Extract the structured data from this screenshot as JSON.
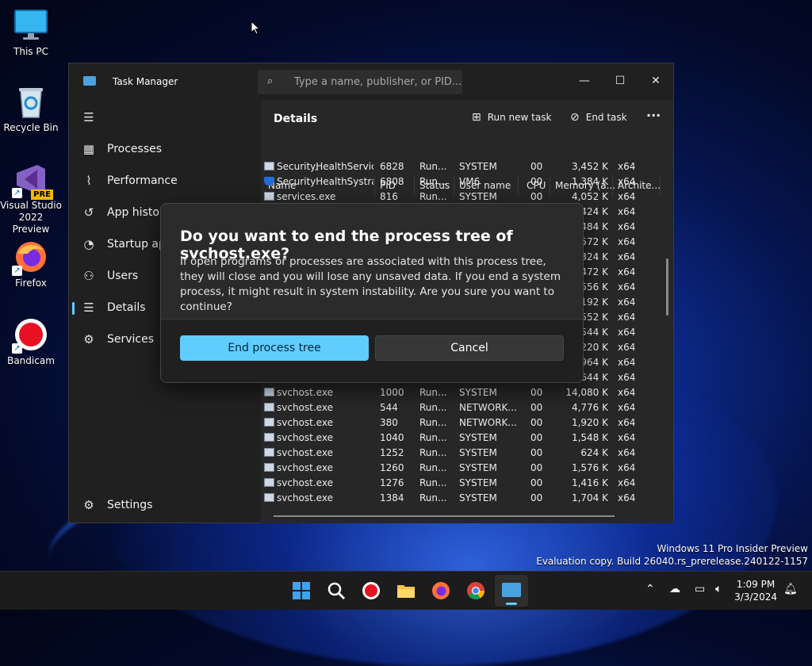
{
  "desktop": {
    "icons": [
      {
        "label": "This PC",
        "icon": "monitor-icon"
      },
      {
        "label": "Recycle Bin",
        "icon": "recycle-bin-icon"
      },
      {
        "label": "Visual Studio 2022 Preview",
        "badge": "PRE",
        "icon": "visual-studio-icon"
      },
      {
        "label": "Firefox",
        "icon": "firefox-icon"
      },
      {
        "label": "Bandicam",
        "icon": "bandicam-icon"
      }
    ]
  },
  "window": {
    "title": "Task Manager",
    "search_placeholder": "Type a name, publisher, or PID...",
    "controls": {
      "minimize": "—",
      "maximize": "☐",
      "close": "✕"
    }
  },
  "sidebar": {
    "menu_icon": "☰",
    "items": [
      {
        "label": "Processes",
        "icon": "processes-icon"
      },
      {
        "label": "Performance",
        "icon": "performance-icon"
      },
      {
        "label": "App history",
        "icon": "app-history-icon"
      },
      {
        "label": "Startup apps",
        "icon": "startup-apps-icon"
      },
      {
        "label": "Users",
        "icon": "users-icon"
      },
      {
        "label": "Details",
        "icon": "details-icon",
        "active": true
      },
      {
        "label": "Services",
        "icon": "services-icon"
      }
    ],
    "settings": "Settings"
  },
  "details": {
    "header": "Details",
    "run_new_task": "Run new task",
    "end_task": "End task",
    "more": "···",
    "columns": [
      "Name",
      "PID",
      "Status",
      "User name",
      "CPU",
      "Memory (a...",
      "Archite..."
    ],
    "rows": [
      {
        "name": "SecurityHealthServic...",
        "pid": "6828",
        "status": "Run...",
        "user": "SYSTEM",
        "cpu": "00",
        "mem": "3,452 K",
        "arch": "x64",
        "icon": "app"
      },
      {
        "name": "SecurityHealthSystra...",
        "pid": "6808",
        "status": "Run...",
        "user": "VM6",
        "cpu": "00",
        "mem": "1,384 K",
        "arch": "x64",
        "icon": "shield"
      },
      {
        "name": "services.exe",
        "pid": "816",
        "status": "Run...",
        "user": "SYSTEM",
        "cpu": "00",
        "mem": "4,052 K",
        "arch": "x64",
        "icon": "app"
      },
      {
        "name": "",
        "pid": "",
        "status": "",
        "user": "",
        "cpu": "",
        "mem": "424 K",
        "arch": "x64",
        "icon": "none"
      },
      {
        "name": "",
        "pid": "",
        "status": "",
        "user": "",
        "cpu": "",
        "mem": "484 K",
        "arch": "x64",
        "icon": "none"
      },
      {
        "name": "",
        "pid": "",
        "status": "",
        "user": "",
        "cpu": "",
        "mem": "572 K",
        "arch": "x64",
        "icon": "none"
      },
      {
        "name": "",
        "pid": "",
        "status": "",
        "user": "",
        "cpu": "",
        "mem": "324 K",
        "arch": "x64",
        "icon": "none"
      },
      {
        "name": "",
        "pid": "",
        "status": "",
        "user": "",
        "cpu": "",
        "mem": "472 K",
        "arch": "x64",
        "icon": "none"
      },
      {
        "name": "",
        "pid": "",
        "status": "",
        "user": "",
        "cpu": "",
        "mem": "556 K",
        "arch": "x64",
        "icon": "none"
      },
      {
        "name": "",
        "pid": "",
        "status": "",
        "user": "",
        "cpu": "",
        "mem": "192 K",
        "arch": "x64",
        "icon": "none"
      },
      {
        "name": "",
        "pid": "",
        "status": "",
        "user": "",
        "cpu": "",
        "mem": "552 K",
        "arch": "x64",
        "icon": "none"
      },
      {
        "name": "",
        "pid": "",
        "status": "",
        "user": "",
        "cpu": "",
        "mem": "544 K",
        "arch": "x64",
        "icon": "none"
      },
      {
        "name": "",
        "pid": "",
        "status": "",
        "user": "",
        "cpu": "",
        "mem": "220 K",
        "arch": "x64",
        "icon": "none"
      },
      {
        "name": "",
        "pid": "",
        "status": "",
        "user": "",
        "cpu": "",
        "mem": "964 K",
        "arch": "x64",
        "icon": "none"
      },
      {
        "name": "",
        "pid": "",
        "status": "",
        "user": "",
        "cpu": "",
        "mem": "644 K",
        "arch": "x64",
        "icon": "none"
      },
      {
        "name": "svchost.exe",
        "pid": "1000",
        "status": "Run...",
        "user": "SYSTEM",
        "cpu": "00",
        "mem": "14,080 K",
        "arch": "x64",
        "icon": "app"
      },
      {
        "name": "svchost.exe",
        "pid": "544",
        "status": "Run...",
        "user": "NETWORK...",
        "cpu": "00",
        "mem": "4,776 K",
        "arch": "x64",
        "icon": "app"
      },
      {
        "name": "svchost.exe",
        "pid": "380",
        "status": "Run...",
        "user": "NETWORK...",
        "cpu": "00",
        "mem": "1,920 K",
        "arch": "x64",
        "icon": "app"
      },
      {
        "name": "svchost.exe",
        "pid": "1040",
        "status": "Run...",
        "user": "SYSTEM",
        "cpu": "00",
        "mem": "1,548 K",
        "arch": "x64",
        "icon": "app"
      },
      {
        "name": "svchost.exe",
        "pid": "1252",
        "status": "Run...",
        "user": "SYSTEM",
        "cpu": "00",
        "mem": "624 K",
        "arch": "x64",
        "icon": "app"
      },
      {
        "name": "svchost.exe",
        "pid": "1260",
        "status": "Run...",
        "user": "SYSTEM",
        "cpu": "00",
        "mem": "1,576 K",
        "arch": "x64",
        "icon": "app"
      },
      {
        "name": "svchost.exe",
        "pid": "1276",
        "status": "Run...",
        "user": "SYSTEM",
        "cpu": "00",
        "mem": "1,416 K",
        "arch": "x64",
        "icon": "app"
      },
      {
        "name": "svchost.exe",
        "pid": "1384",
        "status": "Run...",
        "user": "SYSTEM",
        "cpu": "00",
        "mem": "1,704 K",
        "arch": "x64",
        "icon": "app"
      }
    ]
  },
  "dialog": {
    "title": "Do you want to end the process tree of svchost.exe?",
    "message": "If open programs or processes are associated with this process tree, they will close and you will lose any unsaved data. If you end a system process, it might result in system instability. Are you sure you want to continue?",
    "confirm": "End process tree",
    "cancel": "Cancel"
  },
  "watermark": {
    "line1": "Windows 11 Pro Insider Preview",
    "line2": "Evaluation copy. Build 26040.rs_prerelease.240122-1157"
  },
  "taskbar": {
    "apps": [
      "start-icon",
      "search-icon",
      "bandicam-icon",
      "file-explorer-icon",
      "firefox-icon",
      "chrome-icon",
      "task-manager-icon"
    ],
    "time": "1:09 PM",
    "date": "3/3/2024",
    "colors": {
      "accent": "#60cdff",
      "taskbar": "#1c1c1c"
    }
  }
}
